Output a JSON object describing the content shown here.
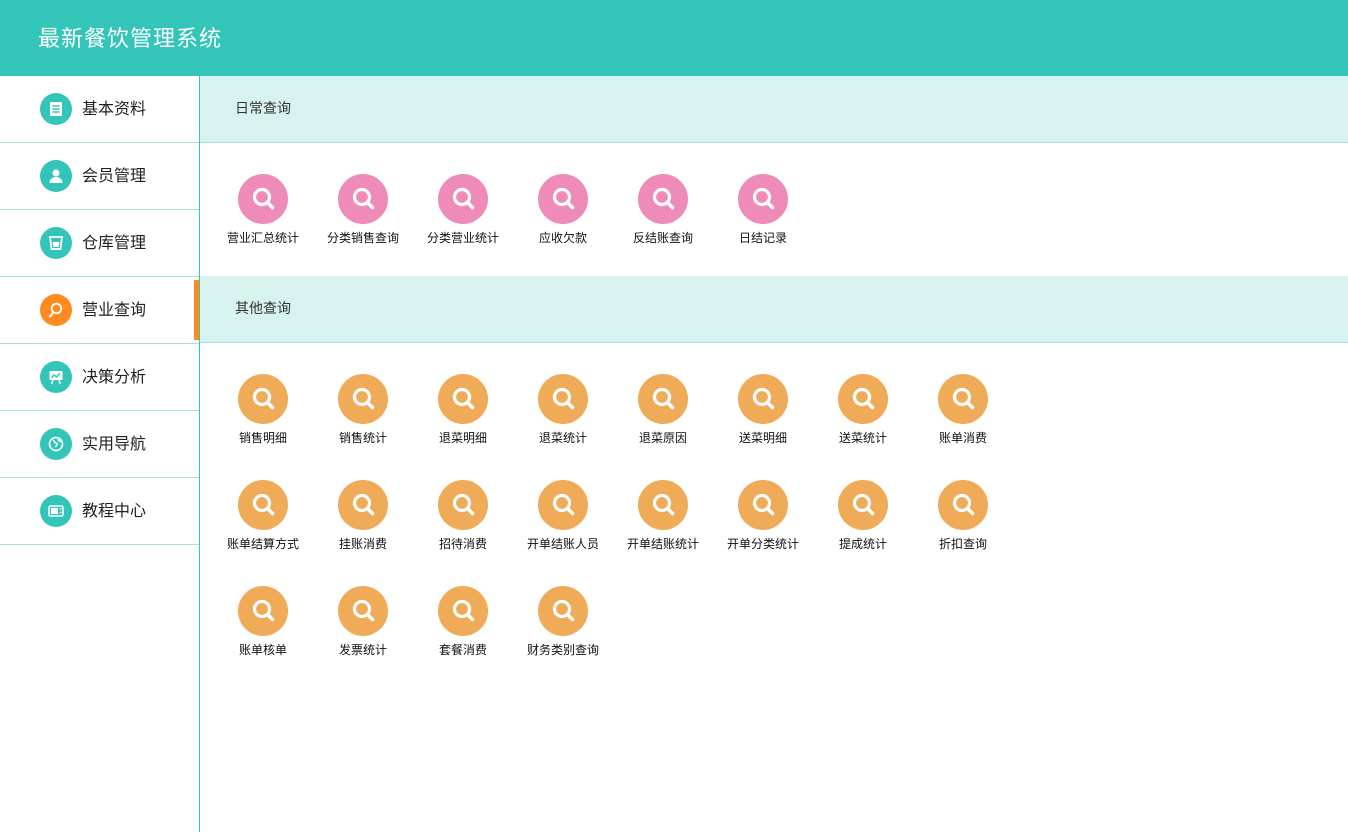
{
  "app": {
    "title": "最新餐饮管理系统"
  },
  "sidebar": {
    "items": [
      {
        "label": "基本资料",
        "icon": "document-icon"
      },
      {
        "label": "会员管理",
        "icon": "user-icon"
      },
      {
        "label": "仓库管理",
        "icon": "cup-icon"
      },
      {
        "label": "营业查询",
        "icon": "search-icon",
        "active": true
      },
      {
        "label": "决策分析",
        "icon": "presentation-icon"
      },
      {
        "label": "实用导航",
        "icon": "globe-icon"
      },
      {
        "label": "教程中心",
        "icon": "video-icon"
      }
    ]
  },
  "sections": {
    "daily": {
      "title": "日常查询",
      "items": [
        "营业汇总统计",
        "分类销售查询",
        "分类营业统计",
        "应收欠款",
        "反结账查询",
        "日结记录"
      ]
    },
    "other": {
      "title": "其他查询",
      "items": [
        "销售明细",
        "销售统计",
        "退菜明细",
        "退菜统计",
        "退菜原因",
        "送菜明细",
        "送菜统计",
        "账单消费",
        "账单结算方式",
        "挂账消费",
        "招待消费",
        "开单结账人员",
        "开单结账统计",
        "开单分类统计",
        "提成统计",
        "折扣查询",
        "账单核单",
        "发票统计",
        "套餐消费",
        "财务类别查询"
      ]
    }
  },
  "colors": {
    "accent": "#33c5b8",
    "active": "#ff8a1f",
    "daily_icon": "#ee8bb8",
    "other_icon": "#efab58"
  }
}
